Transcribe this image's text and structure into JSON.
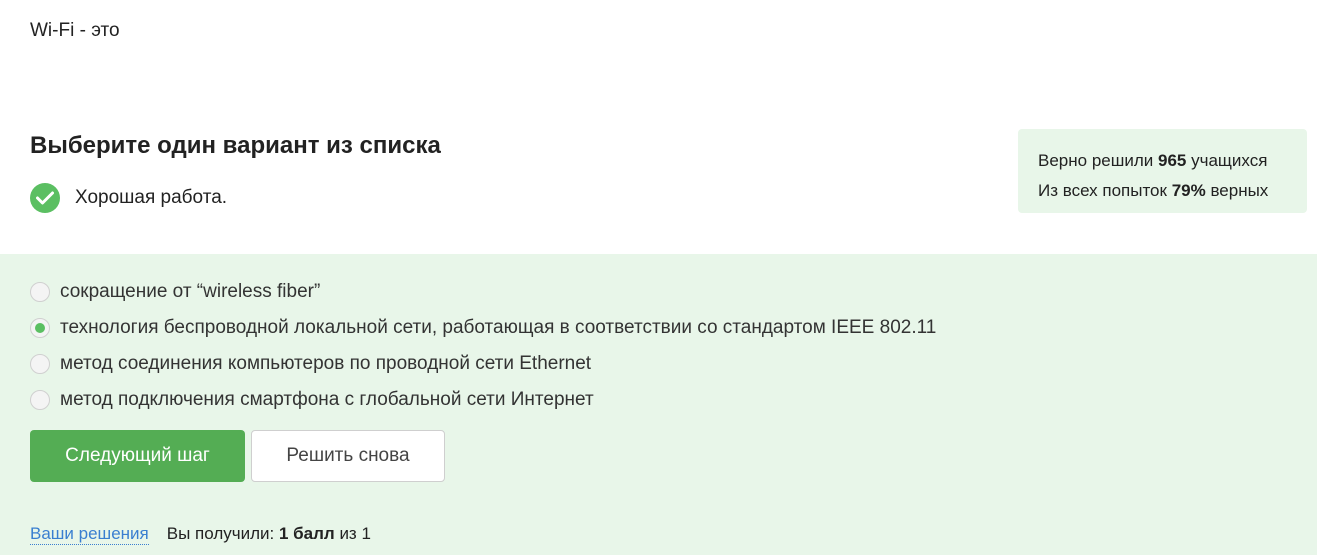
{
  "question": {
    "text": "Wi-Fi - это"
  },
  "section_title": "Выберите один вариант из списка",
  "feedback": {
    "text": "Хорошая работа.",
    "icon": "checkmark-circle-icon"
  },
  "stats": {
    "line1_prefix": "Верно решили",
    "solved_count": "965",
    "line1_suffix": "учащихся",
    "line2_prefix": "Из всех попыток",
    "percent": "79%",
    "line2_suffix": "верных"
  },
  "options": [
    {
      "label": "сокращение от “wireless fiber”",
      "selected": false
    },
    {
      "label": "технология беспроводной локальной сети, работающая в соответствии со стандартом IEEE 802.11",
      "selected": true
    },
    {
      "label": "метод соединения компьютеров по проводной сети Ethernet",
      "selected": false
    },
    {
      "label": "метод подключения смартфона с глобальной сети Интернет",
      "selected": false
    }
  ],
  "buttons": {
    "next": "Следующий шаг",
    "retry": "Решить снова"
  },
  "footer": {
    "solutions_link": "Ваши решения",
    "score_prefix": "Вы получили:",
    "score_value": "1 балл",
    "score_suffix": "из 1"
  },
  "colors": {
    "accent": "#54ad54",
    "panel_bg": "#e8f6e9",
    "link": "#3a7fd0"
  }
}
